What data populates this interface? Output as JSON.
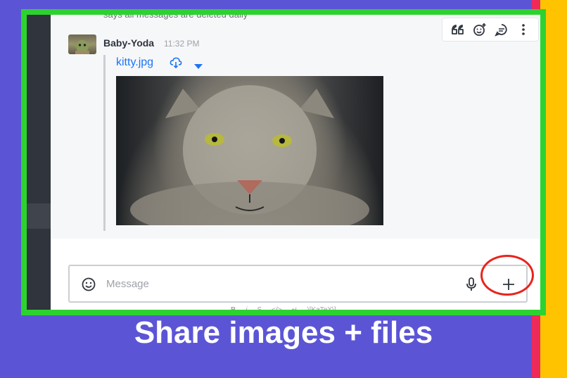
{
  "previous_message": {
    "text": "says all messages are deleted daily"
  },
  "message": {
    "user_name": "Baby-Yoda",
    "time": "11:32 PM",
    "attachment": {
      "file_name": "kitty.jpg",
      "image_alt": "snow leopard"
    }
  },
  "message_actions": [
    {
      "name": "quote-icon"
    },
    {
      "name": "add-reaction-icon"
    },
    {
      "name": "reply-in-thread-icon"
    },
    {
      "name": "kebab-menu-icon"
    }
  ],
  "composer": {
    "placeholder": "Message",
    "format_items": [
      "B",
      "i",
      "S",
      "</>",
      "↵",
      "\\[KaTeX\\]"
    ]
  },
  "caption": "Share images + files",
  "colors": {
    "background": "#5b55d6",
    "highlight_frame": "#2dd230",
    "highlight_circle": "#e8241d",
    "link": "#1d74f5",
    "right_stripe_red": "#ee2a5a",
    "right_stripe_yellow": "#ffc300"
  }
}
